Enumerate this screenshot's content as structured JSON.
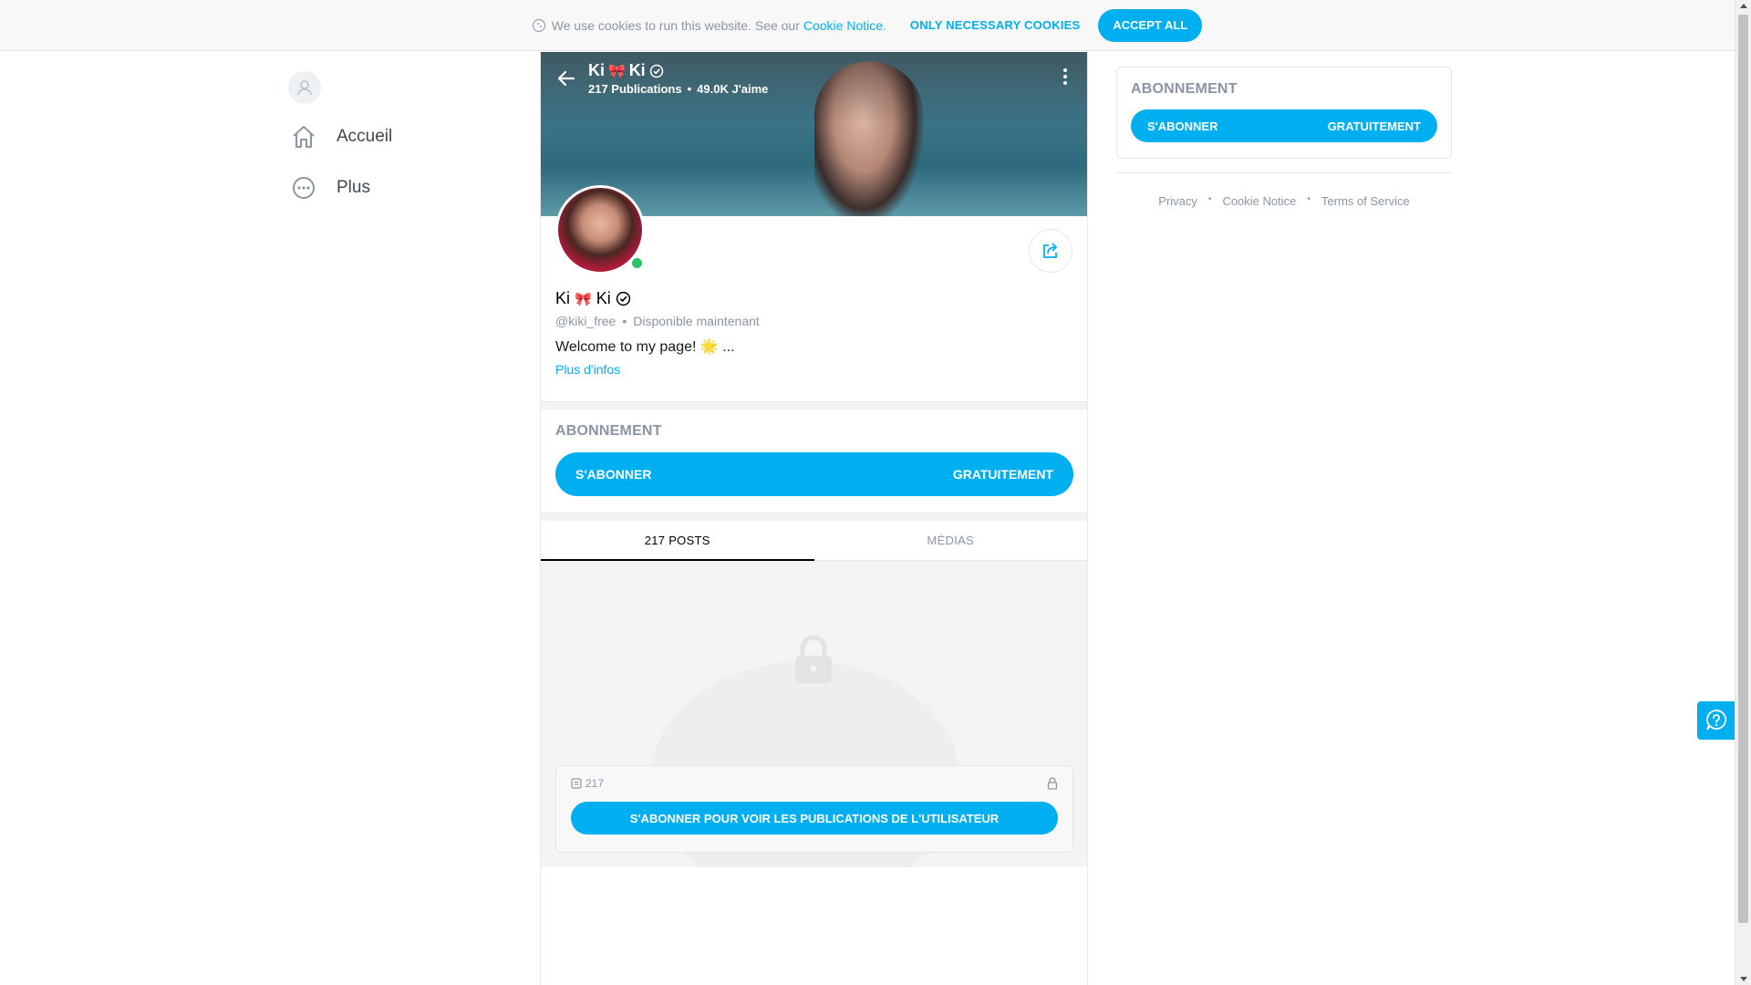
{
  "cookie_bar": {
    "text": "We use cookies to run this website. See our",
    "link": "Cookie Notice",
    "period": ".",
    "necessary_label": "ONLY NECESSARY COOKIES",
    "accept_label": "ACCEPT ALL"
  },
  "sidebar": {
    "items": [
      {
        "label": "Accueil",
        "icon": "home-icon"
      },
      {
        "label": "Plus",
        "icon": "more-circle-icon"
      }
    ]
  },
  "profile": {
    "cover_name_a": "Ki",
    "cover_name_b": "Ki",
    "posts_stat": "217 Publications",
    "likes_stat": "49.0K J'aime",
    "name_a": "Ki",
    "name_b": "Ki",
    "emoji": "🎀",
    "handle": "@kiki_free",
    "status": "Disponible maintenant",
    "bio": "Welcome to my page! 🌟 ...",
    "more_info": "Plus d'infos"
  },
  "subscription": {
    "title": "ABONNEMENT",
    "button_left": "S'ABONNER",
    "button_right": "GRATUITEMENT"
  },
  "tabs": [
    {
      "label": "217 POSTS",
      "active": true
    },
    {
      "label": "MÉDIAS",
      "active": false
    }
  ],
  "locked": {
    "count": "217",
    "button": "S'ABONNER POUR VOIR LES PUBLICATIONS DE L'UTILISATEUR"
  },
  "right": {
    "title": "ABONNEMENT",
    "button_left": "S'ABONNER",
    "button_right": "GRATUITEMENT"
  },
  "footer": {
    "links": [
      "Privacy",
      "Cookie Notice",
      "Terms of Service"
    ]
  },
  "colors": {
    "accent": "#00aff0",
    "muted": "#8a96a3",
    "online": "#2ac36a"
  }
}
